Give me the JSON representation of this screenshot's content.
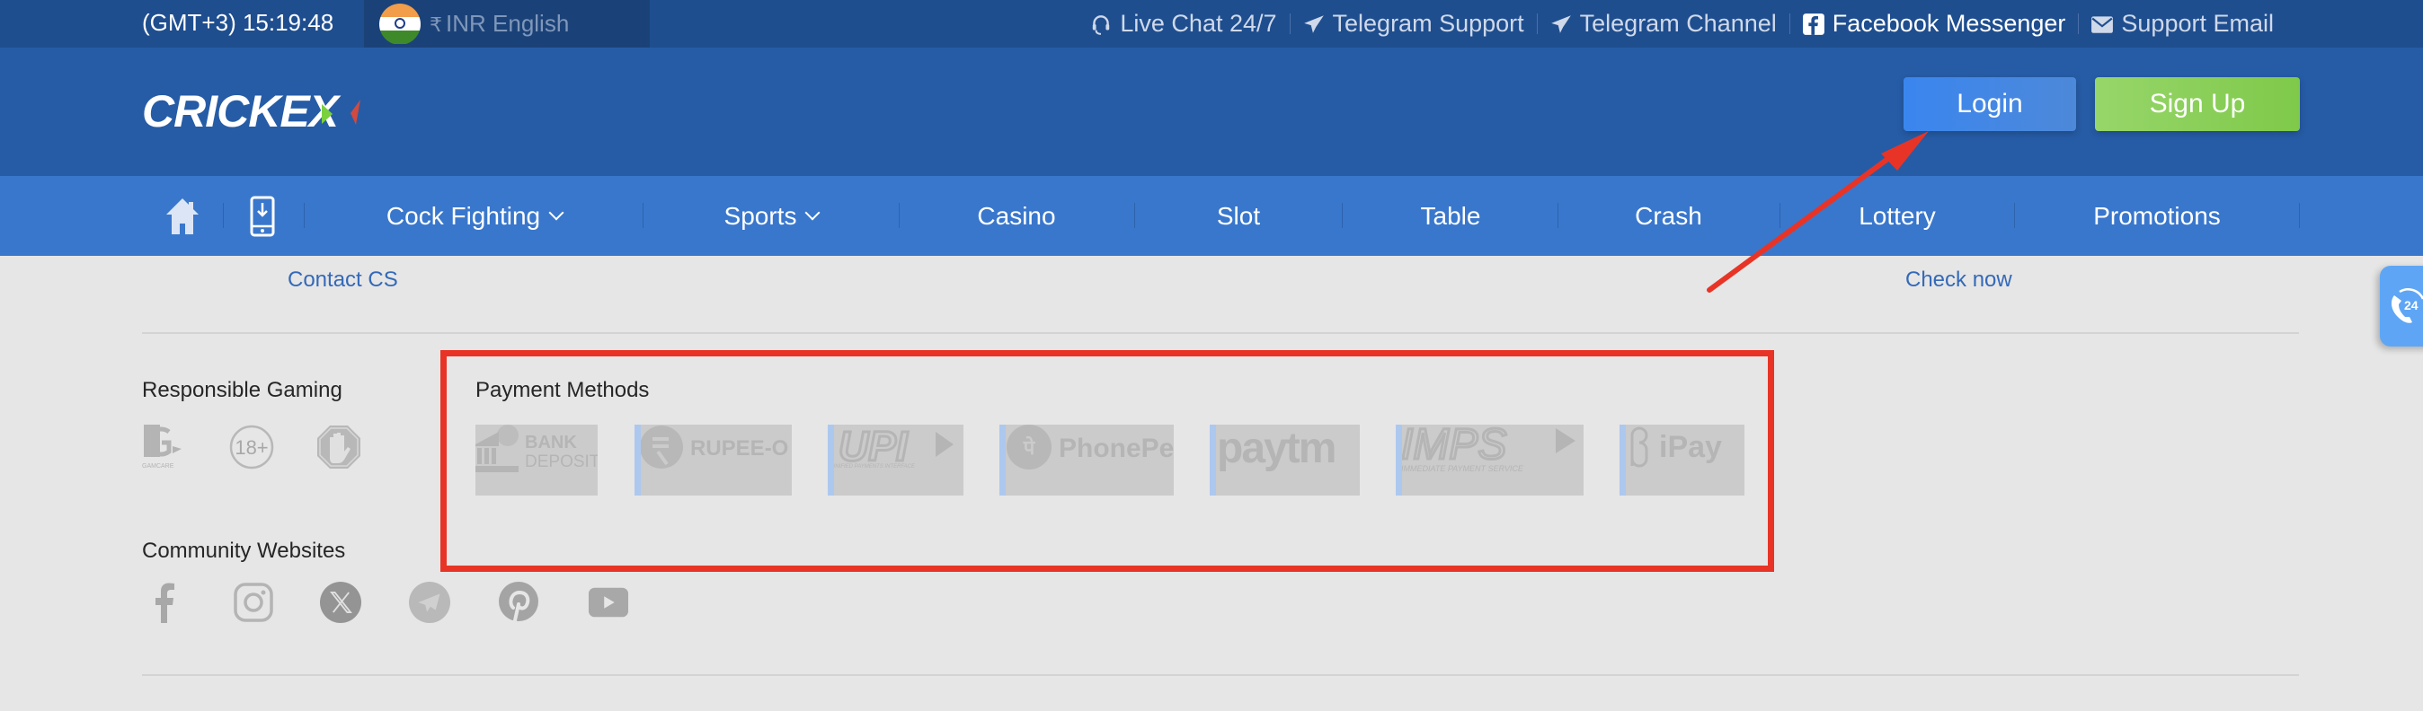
{
  "topbar": {
    "clock": "(GMT+3) 15:19:48",
    "locale": {
      "currency_symbol": "₹",
      "currency": "INR",
      "language": "English",
      "flag": "india-flag"
    },
    "support_links": [
      {
        "label": "Live Chat 24/7",
        "icon": "headset-icon"
      },
      {
        "label": "Telegram Support",
        "icon": "telegram-icon"
      },
      {
        "label": "Telegram Channel",
        "icon": "telegram-icon"
      },
      {
        "label": "Facebook Messenger",
        "icon": "facebook-icon"
      },
      {
        "label": "Support Email",
        "icon": "email-icon"
      }
    ]
  },
  "header": {
    "logo_text": "CRICKEX",
    "login_label": "Login",
    "signup_label": "Sign Up"
  },
  "nav": {
    "items": [
      {
        "label": "Cock Fighting",
        "dropdown": true
      },
      {
        "label": "Sports",
        "dropdown": true
      },
      {
        "label": "Casino",
        "dropdown": false
      },
      {
        "label": "Slot",
        "dropdown": false
      },
      {
        "label": "Table",
        "dropdown": false
      },
      {
        "label": "Crash",
        "dropdown": false
      },
      {
        "label": "Lottery",
        "dropdown": false
      },
      {
        "label": "Promotions",
        "dropdown": false
      }
    ]
  },
  "content": {
    "contact_cs": "Contact CS",
    "check_now": "Check now",
    "responsible_gaming": {
      "title": "Responsible Gaming",
      "icons": [
        "gamcare-icon",
        "age-18-plus-icon",
        "stop-hand-icon"
      ],
      "gamcare_label": "GAMCARE",
      "age_label": "18+"
    },
    "payment_methods": {
      "title": "Payment Methods",
      "logos": [
        {
          "name": "Bank Deposit",
          "line1": "BANK",
          "line2": "DEPOSIT"
        },
        {
          "name": "Rupee-O",
          "line1": "RUPEE-O",
          "line2": ""
        },
        {
          "name": "UPI",
          "line1": "UPI",
          "line2": "UNIFIED PAYMENTS INTERFACE"
        },
        {
          "name": "PhonePe",
          "line1": "PhonePe",
          "line2": ""
        },
        {
          "name": "Paytm",
          "line1": "paytm",
          "line2": ""
        },
        {
          "name": "IMPS",
          "line1": "IMPS",
          "line2": "IMMEDIATE PAYMENT SERVICE"
        },
        {
          "name": "iPay",
          "line1": "iPay",
          "line2": ""
        }
      ]
    },
    "community": {
      "title": "Community Websites",
      "icons": [
        "facebook-icon",
        "instagram-icon",
        "x-twitter-icon",
        "telegram-icon",
        "pinterest-icon",
        "youtube-icon"
      ]
    }
  },
  "widget": {
    "label": "24"
  },
  "colors": {
    "topbar_bg": "#1f4e8f",
    "header_bg": "#265ca6",
    "nav_bg": "#3977cc",
    "login_btn": "#3a86ef",
    "signup_btn": "#7fc94a",
    "link_blue": "#3469b8",
    "annotation_red": "#e83426",
    "page_bg": "#e6e6e6"
  }
}
